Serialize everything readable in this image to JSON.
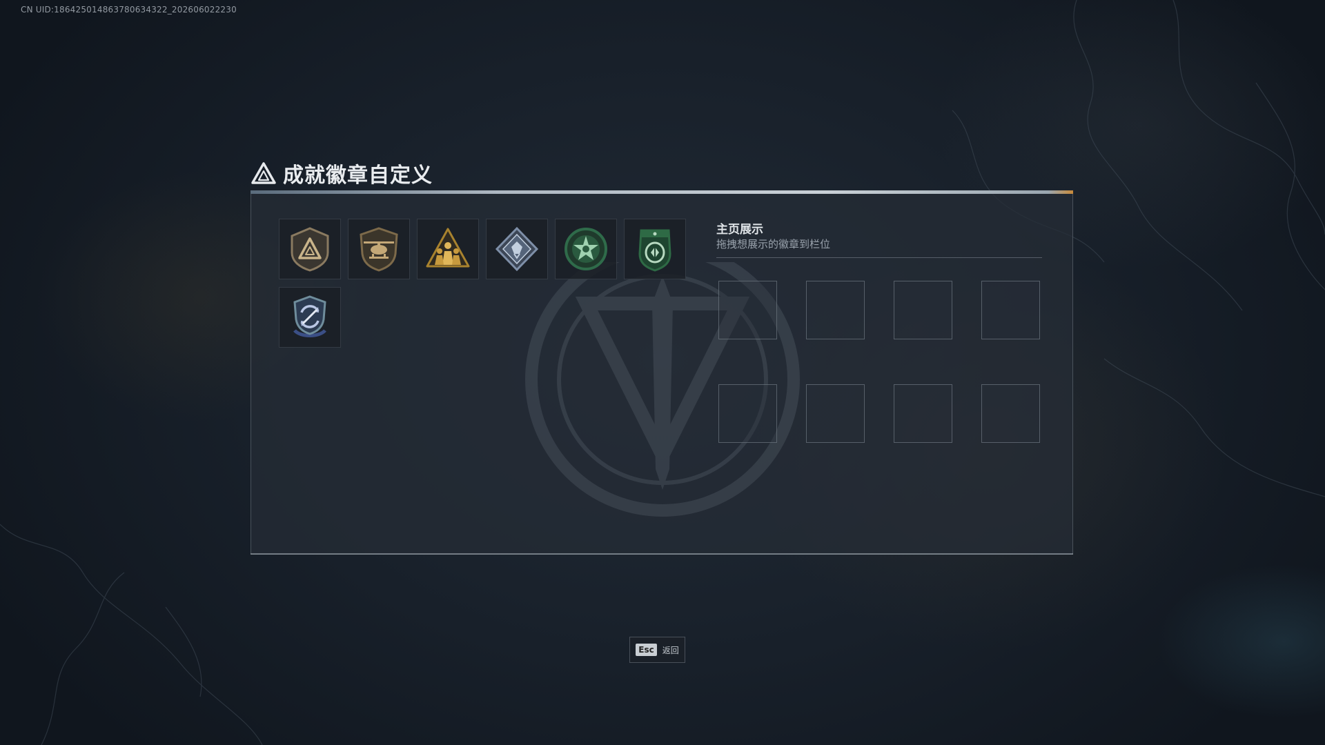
{
  "uid_text": "CN UID:18642501486378063432​2_202606022230",
  "title": "成就徽章自定义",
  "title_icon": "triangle-logo-icon",
  "badges": [
    {
      "name": "triangle-shield-badge",
      "colors": {
        "main": "#8a7a60",
        "accent": "#c9b48a"
      }
    },
    {
      "name": "helicopter-shield-badge",
      "colors": {
        "main": "#7d6a4a",
        "accent": "#c4a877"
      }
    },
    {
      "name": "soldiers-triangle-badge",
      "colors": {
        "main": "#a8822e",
        "accent": "#e0b659"
      }
    },
    {
      "name": "diamond-crystal-badge",
      "colors": {
        "main": "#7e8fa8",
        "accent": "#c2cfdf"
      }
    },
    {
      "name": "green-star-badge",
      "colors": {
        "main": "#2f6b4a",
        "accent": "#9fd1b0"
      }
    },
    {
      "name": "green-shield-badge",
      "colors": {
        "main": "#2e6a45",
        "accent": "#b7d9c0"
      }
    },
    {
      "name": "blue-cycle-shield-badge",
      "colors": {
        "main": "#3b4f86",
        "accent": "#b9c6e4"
      }
    }
  ],
  "display": {
    "title": "主页展示",
    "subtitle": "拖拽想展示的徽章到栏位",
    "slot_count": 8
  },
  "esc": {
    "key": "Esc",
    "label": "返回"
  }
}
